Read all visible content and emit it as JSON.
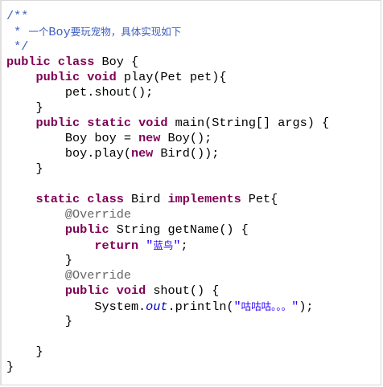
{
  "colors": {
    "comment": "#3f5fbf",
    "keyword": "#7f0055",
    "string": "#2a00ff",
    "annotation": "#646464",
    "static_field": "#0000c0",
    "plain": "#000000"
  },
  "code": {
    "lines": [
      [
        {
          "t": "/**",
          "k": "comment"
        }
      ],
      [
        {
          "t": " * ",
          "k": "comment"
        },
        {
          "t": "一个",
          "k": "comment",
          "cjk": true
        },
        {
          "t": "Boy",
          "k": "comment"
        },
        {
          "t": "要玩宠物，具体实现如下",
          "k": "comment",
          "cjk": true
        }
      ],
      [
        {
          "t": " */",
          "k": "comment"
        }
      ],
      [
        {
          "t": "public",
          "k": "keyword"
        },
        {
          "t": " ",
          "k": "plain"
        },
        {
          "t": "class",
          "k": "keyword"
        },
        {
          "t": " Boy {",
          "k": "plain"
        }
      ],
      [
        {
          "t": "    ",
          "k": "plain"
        },
        {
          "t": "public",
          "k": "keyword"
        },
        {
          "t": " ",
          "k": "plain"
        },
        {
          "t": "void",
          "k": "keyword"
        },
        {
          "t": " play(Pet pet){",
          "k": "plain"
        }
      ],
      [
        {
          "t": "        pet.shout();",
          "k": "plain"
        }
      ],
      [
        {
          "t": "    }",
          "k": "plain"
        }
      ],
      [
        {
          "t": "    ",
          "k": "plain"
        },
        {
          "t": "public",
          "k": "keyword"
        },
        {
          "t": " ",
          "k": "plain"
        },
        {
          "t": "static",
          "k": "keyword"
        },
        {
          "t": " ",
          "k": "plain"
        },
        {
          "t": "void",
          "k": "keyword"
        },
        {
          "t": " main(String[] args) {",
          "k": "plain"
        }
      ],
      [
        {
          "t": "        Boy boy = ",
          "k": "plain"
        },
        {
          "t": "new",
          "k": "keyword"
        },
        {
          "t": " Boy();",
          "k": "plain"
        }
      ],
      [
        {
          "t": "        boy.play(",
          "k": "plain"
        },
        {
          "t": "new",
          "k": "keyword"
        },
        {
          "t": " Bird());",
          "k": "plain"
        }
      ],
      [
        {
          "t": "    }",
          "k": "plain"
        }
      ],
      [],
      [
        {
          "t": "    ",
          "k": "plain"
        },
        {
          "t": "static",
          "k": "keyword"
        },
        {
          "t": " ",
          "k": "plain"
        },
        {
          "t": "class",
          "k": "keyword"
        },
        {
          "t": " Bird ",
          "k": "plain"
        },
        {
          "t": "implements",
          "k": "keyword"
        },
        {
          "t": " Pet{",
          "k": "plain"
        }
      ],
      [
        {
          "t": "        ",
          "k": "plain"
        },
        {
          "t": "@Override",
          "k": "annotation"
        }
      ],
      [
        {
          "t": "        ",
          "k": "plain"
        },
        {
          "t": "public",
          "k": "keyword"
        },
        {
          "t": " String getName() {",
          "k": "plain"
        }
      ],
      [
        {
          "t": "            ",
          "k": "plain"
        },
        {
          "t": "return",
          "k": "keyword"
        },
        {
          "t": " ",
          "k": "plain"
        },
        {
          "t": "\"",
          "k": "string"
        },
        {
          "t": "蓝鸟",
          "k": "string",
          "cjk": true
        },
        {
          "t": "\"",
          "k": "string"
        },
        {
          "t": ";",
          "k": "plain"
        }
      ],
      [
        {
          "t": "        }",
          "k": "plain"
        }
      ],
      [
        {
          "t": "        ",
          "k": "plain"
        },
        {
          "t": "@Override",
          "k": "annotation"
        }
      ],
      [
        {
          "t": "        ",
          "k": "plain"
        },
        {
          "t": "public",
          "k": "keyword"
        },
        {
          "t": " ",
          "k": "plain"
        },
        {
          "t": "void",
          "k": "keyword"
        },
        {
          "t": " shout() {",
          "k": "plain"
        }
      ],
      [
        {
          "t": "            System.",
          "k": "plain"
        },
        {
          "t": "out",
          "k": "static_field"
        },
        {
          "t": ".println(",
          "k": "plain"
        },
        {
          "t": "\"",
          "k": "string"
        },
        {
          "t": "咕咕咕。。。",
          "k": "string",
          "cjk": true
        },
        {
          "t": "\"",
          "k": "string"
        },
        {
          "t": ");",
          "k": "plain"
        }
      ],
      [
        {
          "t": "        }",
          "k": "plain"
        }
      ],
      [],
      [
        {
          "t": "    }",
          "k": "plain"
        }
      ],
      [
        {
          "t": "}",
          "k": "plain"
        }
      ]
    ]
  }
}
